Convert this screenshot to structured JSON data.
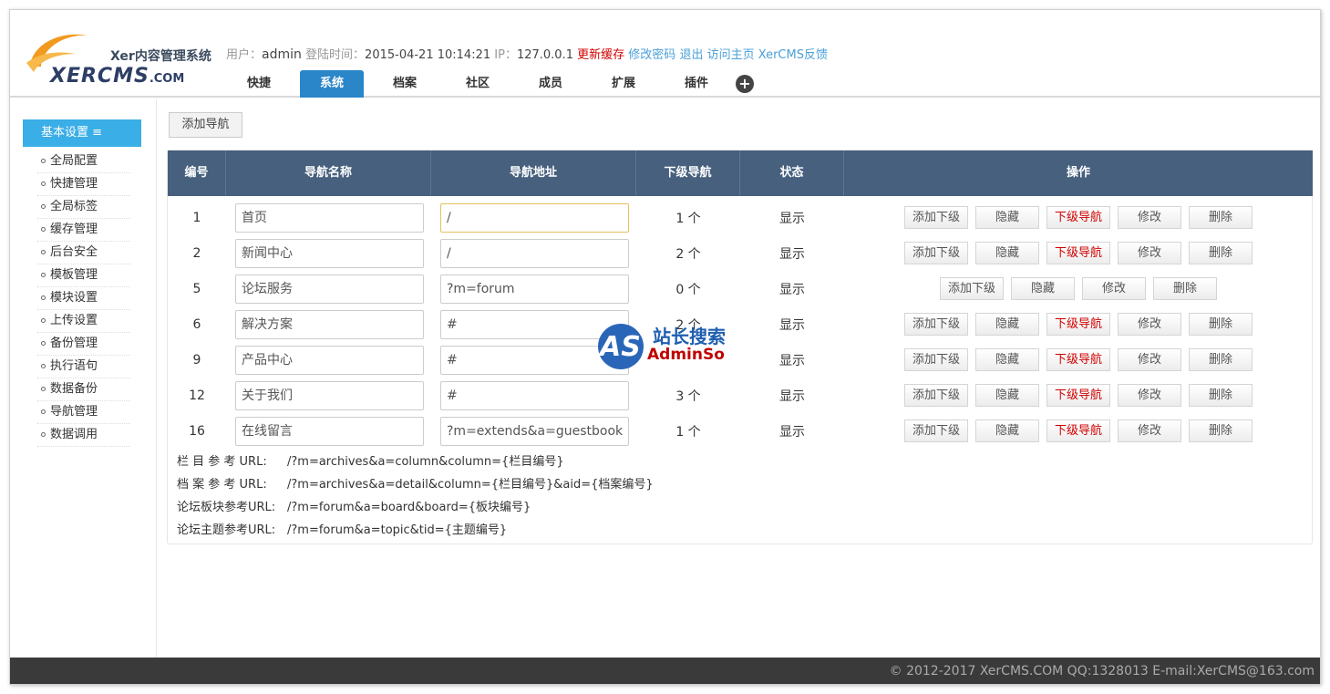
{
  "header": {
    "logo_sub": "Xer内容管理系统",
    "logo_main": "XERCMS",
    "logo_suffix": ".COM",
    "user_label": "用户：",
    "user_value": "admin",
    "login_label": "登陆时间：",
    "login_value": "2015-04-21 10:14:21",
    "ip_label": "IP：",
    "ip_value": "127.0.0.1",
    "refresh_cache": "更新缓存",
    "change_password": "修改密码",
    "logout": "退出",
    "visit_home": "访问主页",
    "feedback": "XerCMS反馈"
  },
  "tabs": [
    {
      "label": "快捷"
    },
    {
      "label": "系统",
      "active": true
    },
    {
      "label": "档案"
    },
    {
      "label": "社区"
    },
    {
      "label": "成员"
    },
    {
      "label": "扩展"
    },
    {
      "label": "插件"
    }
  ],
  "tab_add": "+",
  "sidebar": {
    "heading": "基本设置 ≡",
    "items": [
      {
        "label": "全局配置"
      },
      {
        "label": "快捷管理"
      },
      {
        "label": "全局标签"
      },
      {
        "label": "缓存管理"
      },
      {
        "label": "后台安全"
      },
      {
        "label": "模板管理"
      },
      {
        "label": "模块设置"
      },
      {
        "label": "上传设置"
      },
      {
        "label": "备份管理"
      },
      {
        "label": "执行语句"
      },
      {
        "label": "数据备份"
      },
      {
        "label": "导航管理"
      },
      {
        "label": "数据调用"
      }
    ]
  },
  "main": {
    "add_nav_button": "添加导航",
    "columns": [
      "编号",
      "导航名称",
      "导航地址",
      "下级导航",
      "状态",
      "操作"
    ],
    "rows": [
      {
        "id": "1",
        "name": "首页",
        "url": "/",
        "sub": "1 个",
        "status": "显示",
        "has_sub": true
      },
      {
        "id": "2",
        "name": "新闻中心",
        "url": "/",
        "sub": "2 个",
        "status": "显示",
        "has_sub": true
      },
      {
        "id": "5",
        "name": "论坛服务",
        "url": "?m=forum",
        "sub": "0 个",
        "status": "显示",
        "has_sub": false
      },
      {
        "id": "6",
        "name": "解决方案",
        "url": "#",
        "sub": "2 个",
        "status": "显示",
        "has_sub": true
      },
      {
        "id": "9",
        "name": "产品中心",
        "url": "#",
        "sub": "",
        "status": "显示",
        "has_sub": true
      },
      {
        "id": "12",
        "name": "关于我们",
        "url": "#",
        "sub": "3 个",
        "status": "显示",
        "has_sub": true
      },
      {
        "id": "16",
        "name": "在线留言",
        "url": "?m=extends&a=guestbook",
        "sub": "1 个",
        "status": "显示",
        "has_sub": true
      }
    ],
    "ops": {
      "add_sub": "添加下级",
      "hide": "隐藏",
      "sub_nav": "下级导航",
      "edit": "修改",
      "delete": "删除"
    },
    "refs": [
      {
        "label": "栏 目 参 考 URL:",
        "value": "/?m=archives&a=column&column={栏目编号}"
      },
      {
        "label": "档 案 参 考 URL:",
        "value": "/?m=archives&a=detail&column={栏目编号}&aid={档案编号}"
      },
      {
        "label": "论坛板块参考URL:",
        "value": "/?m=forum&a=board&board={板块编号}"
      },
      {
        "label": "论坛主题参考URL:",
        "value": "/?m=forum&a=topic&tid={主题编号}"
      }
    ]
  },
  "watermark": {
    "circle_text": "AS",
    "cn": "站长搜索",
    "en": "AdminSo"
  },
  "footer": {
    "text": "© 2012-2017 XerCMS.COM    QQ:1328013  E-mail:XerCMS@163.com"
  },
  "colors": {
    "header_table": "#46607e",
    "tab_active": "#2a86c8",
    "sidebar_head": "#3aaee6",
    "link_red": "#d00000",
    "link_blue": "#4aa0d8",
    "footer_bg": "#3a3a3a"
  }
}
